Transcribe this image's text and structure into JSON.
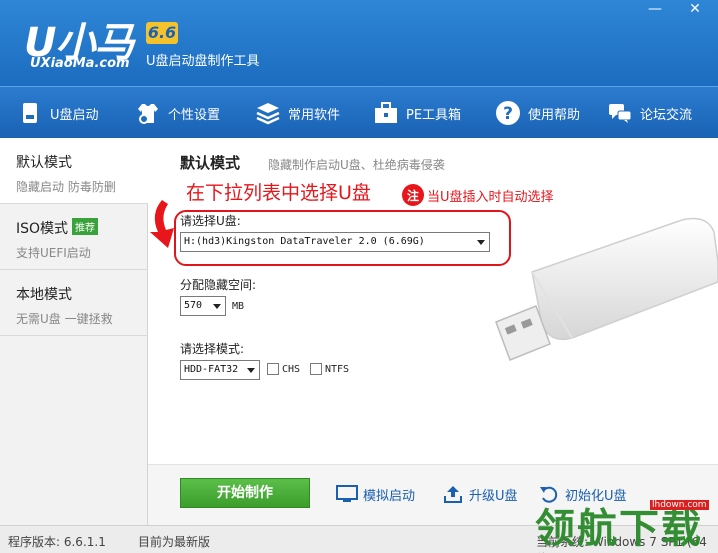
{
  "header": {
    "logo": "U小马",
    "version": "6.6",
    "site": "UXiaoMa.com",
    "subtitle": "U盘启动盘制作工具",
    "minimize": "—",
    "close": "✕"
  },
  "nav": [
    {
      "label": "U盘启动",
      "icon": "usb-drive-icon"
    },
    {
      "label": "个性设置",
      "icon": "shirt-gear-icon"
    },
    {
      "label": "常用软件",
      "icon": "layers-icon"
    },
    {
      "label": "PE工具箱",
      "icon": "toolbox-icon"
    },
    {
      "label": "使用帮助",
      "icon": "help-icon"
    },
    {
      "label": "论坛交流",
      "icon": "chat-icon"
    }
  ],
  "sidebar": [
    {
      "title": "默认模式",
      "desc": "隐藏启动 防毒防删",
      "active": true
    },
    {
      "title": "ISO模式",
      "badge": "推荐",
      "desc": "支持UEFI启动",
      "active": false
    },
    {
      "title": "本地模式",
      "desc": "无需U盘 一键拯救",
      "active": false
    }
  ],
  "main": {
    "title": "默认模式",
    "desc": "隐藏制作启动U盘、杜绝病毒侵袭",
    "annotation": "在下拉列表中选择U盘",
    "note_icon": "注",
    "note": "当U盘插入时自动选择",
    "drive_label": "请选择U盘:",
    "drive_value": "H:(hd3)Kingston DataTraveler 2.0 (6.69G)",
    "hidden_label": "分配隐藏空间:",
    "hidden_value": "570",
    "hidden_unit": "MB",
    "mode_label": "请选择模式:",
    "mode_value": "HDD-FAT32",
    "chs_label": "CHS",
    "ntfs_label": "NTFS"
  },
  "actions": {
    "start": "开始制作",
    "simulate": "模拟启动",
    "upgrade": "升级U盘",
    "init": "初始化U盘"
  },
  "status": {
    "version": "程序版本: 6.6.1.1",
    "latest": "目前为最新版",
    "os": "当前系统: Windows 7 SP1 (64位)"
  },
  "watermark": {
    "text": "领航下载",
    "url": "lhdown.com"
  },
  "colors": {
    "header_blue": "#1c6cc0",
    "annotation_red": "#e8151b",
    "start_green": "#3b9d2b",
    "link_blue": "#1a5fb0"
  }
}
